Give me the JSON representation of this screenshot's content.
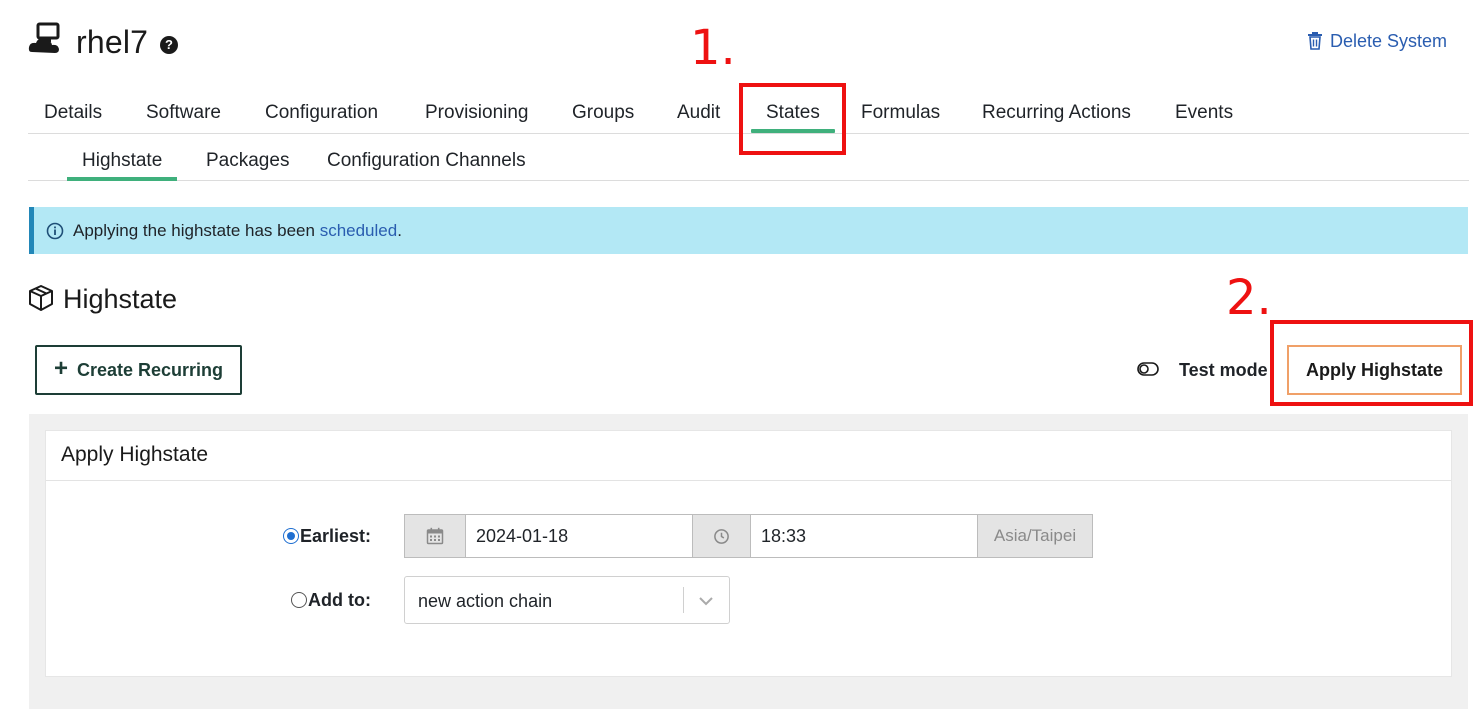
{
  "header": {
    "title": "rhel7",
    "help_glyph": "?",
    "delete_label": "Delete System",
    "system_icon": "server-cloud-icon"
  },
  "tabs": [
    "Details",
    "Software",
    "Configuration",
    "Provisioning",
    "Groups",
    "Audit",
    "States",
    "Formulas",
    "Recurring Actions",
    "Events"
  ],
  "active_tab": "States",
  "subtabs": [
    "Highstate",
    "Packages",
    "Configuration Channels"
  ],
  "active_subtab": "Highstate",
  "annotations": {
    "step1": "1.",
    "step2": "2."
  },
  "alert": {
    "text_before": "Applying the highstate has been ",
    "link": "scheduled",
    "text_after": "."
  },
  "section": {
    "title": "Highstate",
    "icon": "package-icon"
  },
  "actions": {
    "create_recurring": "Create Recurring",
    "create_glyph": "+",
    "test_mode": "Test mode",
    "apply_highstate": "Apply Highstate"
  },
  "panel": {
    "title": "Apply Highstate",
    "earliest_label": "Earliest:",
    "date": "2024-01-18",
    "time": "18:33",
    "timezone": "Asia/Taipei",
    "add_to_label": "Add to:",
    "action_chain": "new action chain"
  },
  "colors": {
    "accent": "#3fb07c",
    "link": "#2a5db0",
    "alert_bg": "#b3e8f5",
    "annotation": "#ee1111",
    "apply_border": "#f0a068"
  }
}
